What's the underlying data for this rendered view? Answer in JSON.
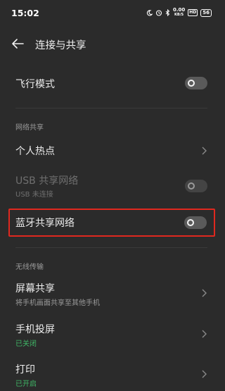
{
  "status_bar": {
    "time": "15:02",
    "icons": [
      "moon-icon",
      "alarm-icon",
      "bluetooth-icon",
      "network-speed-icon",
      "hd-icon",
      "battery-icon"
    ],
    "network_speed_value": "0.00",
    "network_speed_unit": "KB/S",
    "hd_label": "HD",
    "battery_level": "56"
  },
  "header": {
    "title": "连接与共享"
  },
  "airplane": {
    "label": "飞行模式",
    "enabled": false
  },
  "network_sharing_section": {
    "header": "网络共享",
    "hotspot": {
      "label": "个人热点"
    },
    "usb": {
      "label": "USB 共享网络",
      "subtitle": "USB 未连接",
      "enabled": false,
      "disabled": true
    },
    "bluetooth": {
      "label": "蓝牙共享网络",
      "enabled": false,
      "highlighted": true
    }
  },
  "wireless_section": {
    "header": "无线传输",
    "screen_share": {
      "label": "屏幕共享",
      "subtitle": "将手机画面共享至其他手机"
    },
    "cast": {
      "label": "手机投屏",
      "subtitle": "已关闭"
    },
    "print": {
      "label": "打印",
      "subtitle": "已开启"
    }
  },
  "colors": {
    "background": "#2b2b2b",
    "highlight_border": "#e0281f",
    "status_green": "#3fb566"
  }
}
